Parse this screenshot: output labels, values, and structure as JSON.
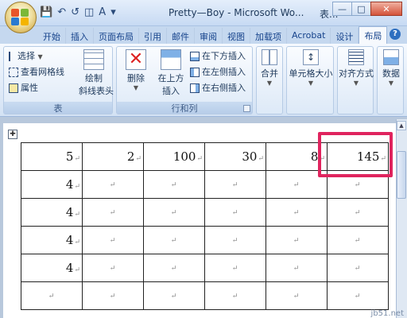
{
  "window": {
    "title": "Pretty—Boy - Microsoft Wo...",
    "title_extra": "表..."
  },
  "qat": [
    "save",
    "undo",
    "redo",
    "print-preview",
    "font-color",
    "customize"
  ],
  "tabs": [
    "开始",
    "插入",
    "页面布局",
    "引用",
    "邮件",
    "审阅",
    "视图",
    "加载项",
    "Acrobat",
    "设计",
    "布局"
  ],
  "active_tab": "布局",
  "ribbon": {
    "table_group": {
      "label": "表",
      "select": "选择",
      "view_gridlines": "查看网格线",
      "properties": "属性",
      "draw_diagonal_line1": "绘制",
      "draw_diagonal_line2": "斜线表头"
    },
    "rows_cols_group": {
      "label": "行和列",
      "delete": "删除",
      "insert_above1": "在上方",
      "insert_above2": "插入",
      "insert_below": "在下方插入",
      "insert_left": "在左侧插入",
      "insert_right": "在右侧插入"
    },
    "merge": "合并",
    "cell_size": "单元格大小",
    "alignment": "对齐方式",
    "data": "数据"
  },
  "table": {
    "rows": [
      [
        "5",
        "2",
        "100",
        "30",
        "8",
        "145"
      ],
      [
        "4",
        "",
        "",
        "",
        "",
        ""
      ],
      [
        "4",
        "",
        "",
        "",
        "",
        ""
      ],
      [
        "4",
        "",
        "",
        "",
        "",
        ""
      ],
      [
        "4",
        "",
        "",
        "",
        "",
        ""
      ],
      [
        "",
        "",
        "",
        "",
        "",
        ""
      ]
    ],
    "highlighted_cell": "145"
  },
  "colors": {
    "highlight": "#e0245e",
    "ribbon": "#dde9f7"
  },
  "watermark": "jb51.net"
}
